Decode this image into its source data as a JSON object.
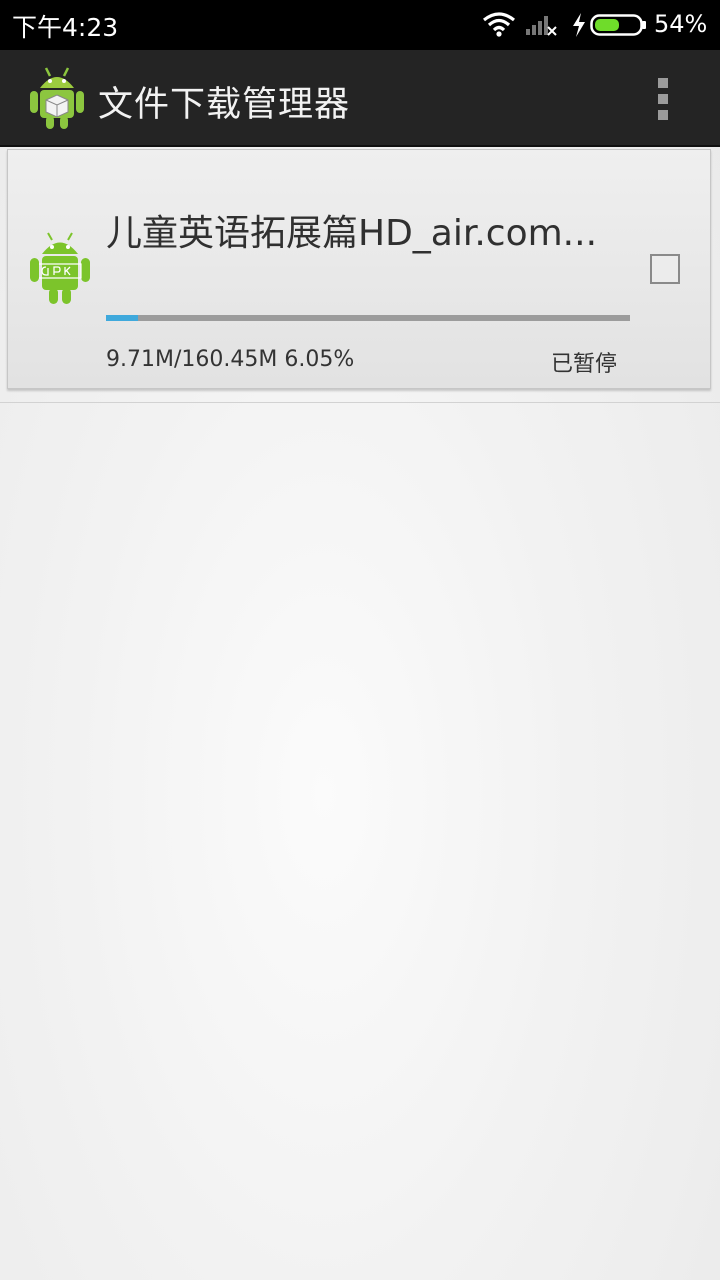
{
  "status_bar": {
    "time": "下午4:23",
    "battery_percent": "54%",
    "battery_level": 0.54,
    "icons": [
      "wifi-icon",
      "signal-icon",
      "charging-icon",
      "battery-icon"
    ]
  },
  "action_bar": {
    "title": "文件下载管理器",
    "app_icon": "android-box-icon",
    "menu_icon": "overflow-menu-icon"
  },
  "downloads": [
    {
      "file_name": "儿童英语拓展篇HD_air.com...",
      "icon": "apk-icon",
      "progress_text": "9.71M/160.45M   6.05%",
      "progress_fraction": 0.0605,
      "status": "已暂停",
      "checked": false
    }
  ],
  "colors": {
    "status_bar_bg": "#000000",
    "action_bar_bg": "#242424",
    "progress_fill": "#3fa9dc",
    "progress_track": "#9c9c9c",
    "android_green": "#8cc63f"
  }
}
